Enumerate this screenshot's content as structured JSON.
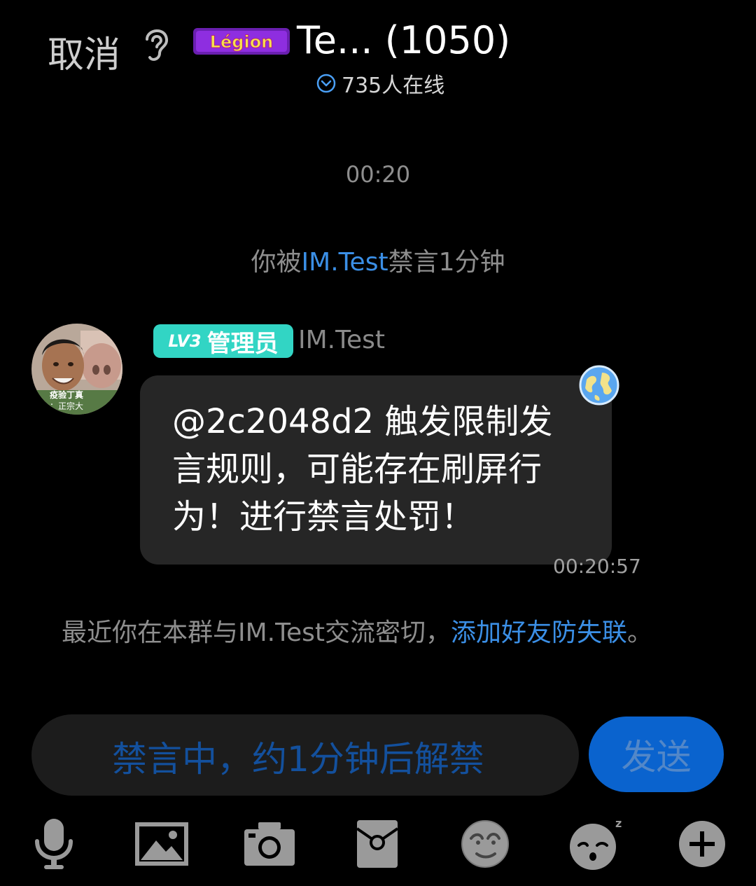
{
  "header": {
    "cancel_label": "取消",
    "logo_text": "Légion",
    "title": "Te... (1050)",
    "online_count": "735人在线"
  },
  "chat": {
    "time_divider": "00:20",
    "mute_notice": {
      "prefix": "你被",
      "user": "IM.Test",
      "suffix": "禁言1分钟"
    },
    "message": {
      "level_badge": "LV3",
      "role_badge": "管理员",
      "sender": "IM.Test",
      "text": "@2c2048d2 触发限制发言规则，可能存在刷屏行为！进行禁言处罚！",
      "time": "00:20:57",
      "avatar_caption_1": "疫验丁真",
      "avatar_caption_2": "：正宗大"
    },
    "friend_notice": {
      "text": "最近你在本群与IM.Test交流密切，",
      "link": "添加好友防失联",
      "end": "。"
    }
  },
  "composer": {
    "placeholder": "禁言中，约1分钟后解禁",
    "send_label": "发送"
  },
  "toolbar": {
    "icons": [
      "microphone-icon",
      "image-icon",
      "camera-icon",
      "red-packet-icon",
      "emoji-icon",
      "sleepy-face-icon",
      "plus-icon"
    ]
  },
  "colors": {
    "background": "#000000",
    "link": "#3b8fe6",
    "badge": "#32d5c4",
    "bubble": "#262626",
    "send_button": "#0a63ce"
  }
}
